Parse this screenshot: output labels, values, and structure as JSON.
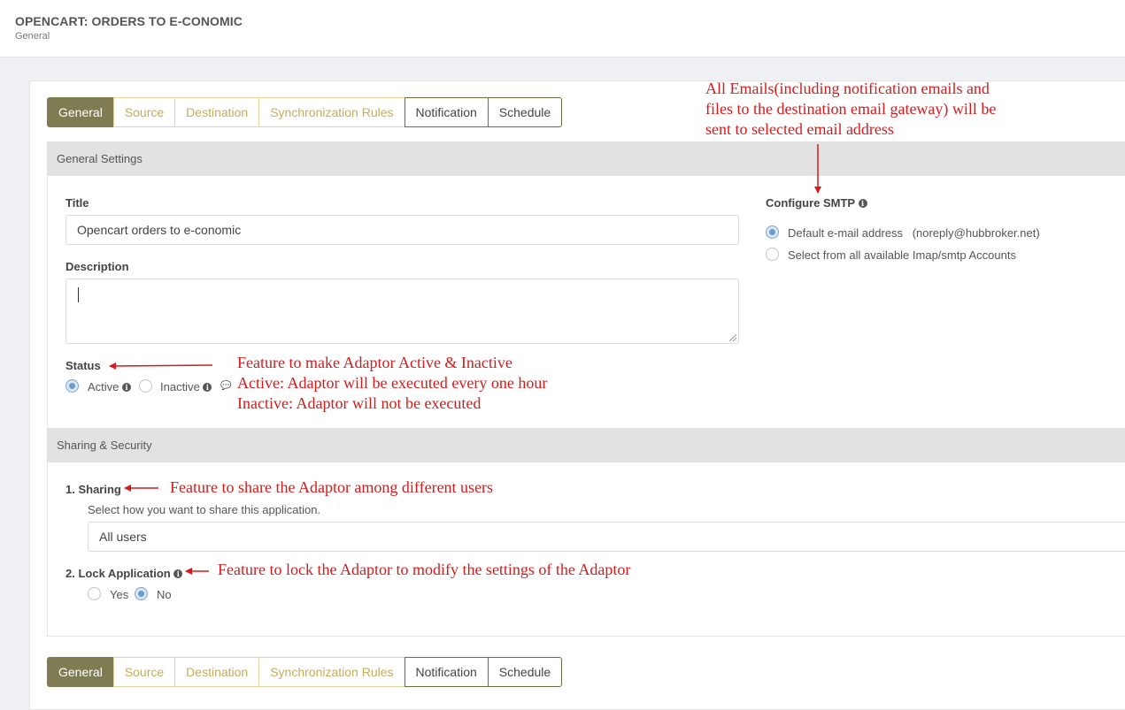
{
  "header": {
    "title": "OPENCART: ORDERS TO E-CONOMIC",
    "subtitle": "General"
  },
  "tabs": [
    {
      "label": "General",
      "state": "active"
    },
    {
      "label": "Source",
      "state": "pending"
    },
    {
      "label": "Destination",
      "state": "pending"
    },
    {
      "label": "Synchronization Rules",
      "state": "pending"
    },
    {
      "label": "Notification",
      "state": "plain"
    },
    {
      "label": "Schedule",
      "state": "plain"
    }
  ],
  "general_settings": {
    "heading": "General Settings",
    "title_label": "Title",
    "title_value": "Opencart orders to e-conomic",
    "description_label": "Description",
    "description_value": "",
    "status_label": "Status",
    "status_options": [
      {
        "label": "Active",
        "checked": true
      },
      {
        "label": "Inactive",
        "checked": false
      }
    ],
    "smtp_label": "Configure SMTP",
    "smtp_options": [
      {
        "label": "Default e-mail address",
        "detail": "(noreply@hubbroker.net)",
        "checked": true
      },
      {
        "label": "Select from all available Imap/smtp Accounts",
        "checked": false
      }
    ]
  },
  "sharing_security": {
    "heading": "Sharing & Security",
    "sharing_label": "1. Sharing",
    "sharing_hint": "Select how you want to share this application.",
    "sharing_value": "All users",
    "lock_label": "2. Lock Application",
    "lock_options": [
      {
        "label": "Yes",
        "checked": false
      },
      {
        "label": "No",
        "checked": true
      }
    ]
  },
  "annotations": {
    "smtp_note": [
      "All Emails(including notification emails and",
      "files to the destination email gateway) will be",
      "sent to selected email address"
    ],
    "status_note": [
      "Feature to make Adaptor Active & Inactive",
      "Active: Adaptor will be executed every one hour",
      "Inactive: Adaptor will not be executed"
    ],
    "sharing_note": "Feature to share the Adaptor among different users",
    "lock_note": "Feature to lock the Adaptor to modify the settings of the Adaptor"
  },
  "colors": {
    "active_tab": "#7e7c50",
    "pending_tab_text": "#c4ad5a",
    "annotation": "#d41b1b",
    "radio_checked": "#6d9ccb"
  }
}
